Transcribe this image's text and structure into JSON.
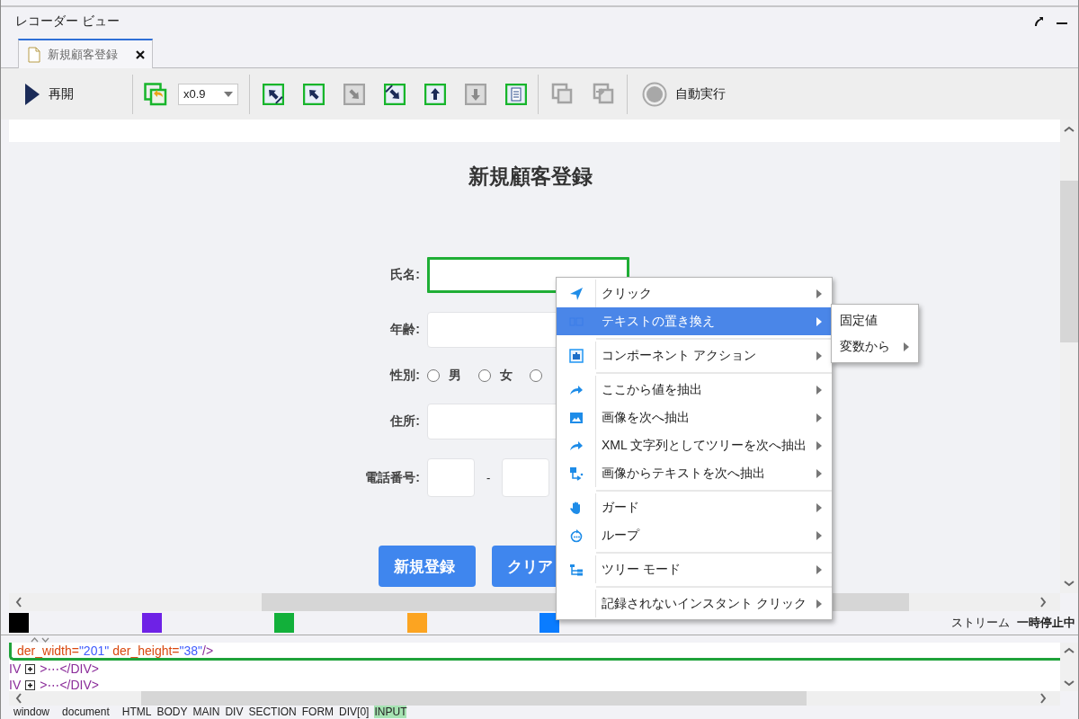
{
  "window": {
    "title": "レコーダー ビュー"
  },
  "tabs": [
    {
      "label": "新規顧客登録",
      "selected": true
    }
  ],
  "toolbar": {
    "resume": {
      "label": "再開"
    },
    "restore": {
      "disabled": false
    },
    "zoom": {
      "value": "x0.9"
    },
    "navigation": [
      {
        "kind": "parent",
        "disabled": false
      },
      {
        "kind": "up-left",
        "disabled": false
      },
      {
        "kind": "down-right",
        "disabled": true
      },
      {
        "kind": "child",
        "disabled": false
      },
      {
        "kind": "up",
        "disabled": false
      },
      {
        "kind": "down",
        "disabled": true
      },
      {
        "kind": "document",
        "disabled": false
      }
    ],
    "windows": [
      {
        "kind": "window-front",
        "disabled": true
      },
      {
        "kind": "window-import",
        "disabled": true
      }
    ],
    "auto_run": {
      "label": "自動実行",
      "active": false
    }
  },
  "page": {
    "heading": "新規顧客登録",
    "fields": [
      {
        "kind": "text",
        "label": "氏名:",
        "highlighted": true
      },
      {
        "kind": "text",
        "label": "年齢:",
        "highlighted": false
      },
      {
        "kind": "radio",
        "label": "性別:",
        "options": [
          {
            "label": "男",
            "selected": false
          },
          {
            "label": "女",
            "selected": false
          },
          {
            "selected": false
          }
        ]
      },
      {
        "kind": "text",
        "label": "住所:",
        "highlighted": false
      },
      {
        "kind": "phone",
        "label": "電話番号:",
        "separator": "-"
      }
    ],
    "buttons": [
      "新規登録",
      "クリア"
    ]
  },
  "context_menu": {
    "groups": [
      [
        {
          "label": "クリック",
          "kind": "send",
          "selected": false,
          "submenu": true
        },
        {
          "label": "テキストの置き換え",
          "kind": "replace",
          "selected": true,
          "submenu": true
        }
      ],
      [
        {
          "label": "コンポーネント アクション",
          "kind": "component",
          "selected": false,
          "submenu": true
        }
      ],
      [
        {
          "label": "ここから値を抽出",
          "kind": "extract",
          "selected": false,
          "submenu": true
        },
        {
          "label": "画像を次へ抽出",
          "kind": "image",
          "selected": false,
          "submenu": true
        },
        {
          "label": "XML 文字列としてツリーを次へ抽出",
          "kind": "extract",
          "selected": false,
          "submenu": true
        },
        {
          "label": "画像からテキストを次へ抽出",
          "kind": "image-text",
          "selected": false,
          "submenu": true
        }
      ],
      [
        {
          "label": "ガード",
          "kind": "hand",
          "selected": false,
          "submenu": true
        },
        {
          "label": "ループ",
          "kind": "loop",
          "selected": false,
          "submenu": true
        }
      ],
      [
        {
          "label": "ツリー モード",
          "kind": "tree",
          "selected": false,
          "submenu": true
        }
      ],
      [
        {
          "label": "記録されないインスタント クリック",
          "selected": false,
          "submenu": true
        }
      ]
    ],
    "submenu": [
      {
        "label": "固定値",
        "submenu": false
      },
      {
        "label": "変数から",
        "submenu": true
      }
    ]
  },
  "swatches": [
    {
      "color": "#000000"
    },
    {
      "color": "#6e22e6"
    },
    {
      "color": "#12b03a"
    },
    {
      "color": "#fca421"
    },
    {
      "color": "#0a7cff"
    }
  ],
  "stream": {
    "label": "ストリーム",
    "status": "一時停止中"
  },
  "xml_view": {
    "lines": [
      {
        "selected": true,
        "tokens": [
          {
            "kind": "attr",
            "text": "der_width="
          },
          {
            "kind": "value",
            "text": "\"201\""
          },
          {
            "kind": "attr",
            "text": "der_height="
          },
          {
            "kind": "value",
            "text": "\"38\""
          },
          {
            "kind": "tag",
            "text": "/>"
          }
        ]
      },
      {
        "selected": false,
        "tokens": [
          {
            "kind": "tag",
            "text": "IV"
          },
          {
            "kind": "expander"
          },
          {
            "kind": "tag",
            "text": ">⋯</DIV>"
          }
        ]
      },
      {
        "selected": false,
        "tokens": [
          {
            "kind": "tag",
            "text": "IV"
          },
          {
            "kind": "expander"
          },
          {
            "kind": "tag",
            "text": ">⋯</DIV>"
          }
        ]
      }
    ]
  },
  "breadcrumb": [
    {
      "label": "window",
      "selected": false
    },
    {
      "label": "document",
      "selected": false
    },
    {
      "label": "HTML",
      "selected": false
    },
    {
      "label": "BODY",
      "selected": false
    },
    {
      "label": "MAIN",
      "selected": false
    },
    {
      "label": "DIV",
      "selected": false
    },
    {
      "label": "SECTION",
      "selected": false
    },
    {
      "label": "FORM",
      "selected": false
    },
    {
      "label": "DIV[0]",
      "selected": false
    },
    {
      "label": "INPUT",
      "selected": true
    }
  ]
}
